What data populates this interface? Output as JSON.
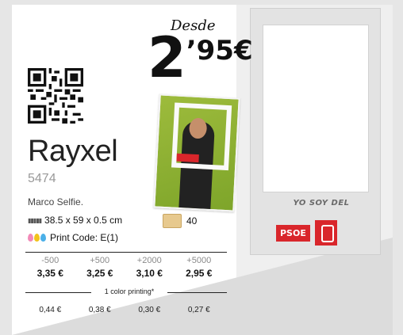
{
  "headline": {
    "from_label": "Desde",
    "price_int": "2",
    "price_dec": "’95€"
  },
  "product": {
    "brand": "Rayxel",
    "code": "5474",
    "description": "Marco Selfie.",
    "size": "38.5 x 59 x 0.5 cm",
    "box_qty": "40",
    "print_code": "Print Code: E(1)"
  },
  "frame_image": {
    "slogan": "YO SOY DEL",
    "logo_text": "PSOE"
  },
  "pricing": {
    "tiers": [
      {
        "qty": "-500",
        "price": "3,35 €"
      },
      {
        "qty": "+500",
        "price": "3,25 €"
      },
      {
        "qty": "+2000",
        "price": "3,10 €"
      },
      {
        "qty": "+5000",
        "price": "2,95 €"
      }
    ],
    "print_note": "1 color printing*",
    "extras": [
      "0,44 €",
      "0,38 €",
      "0,30 €",
      "0,27 €"
    ]
  },
  "icons": {
    "ruler": "ruler-icon",
    "box": "box-icon",
    "print": "ink-drops-icon",
    "qr": "qr-code-icon"
  },
  "colors": {
    "accent_red": "#d9262b",
    "photo_green": "#8db134"
  }
}
